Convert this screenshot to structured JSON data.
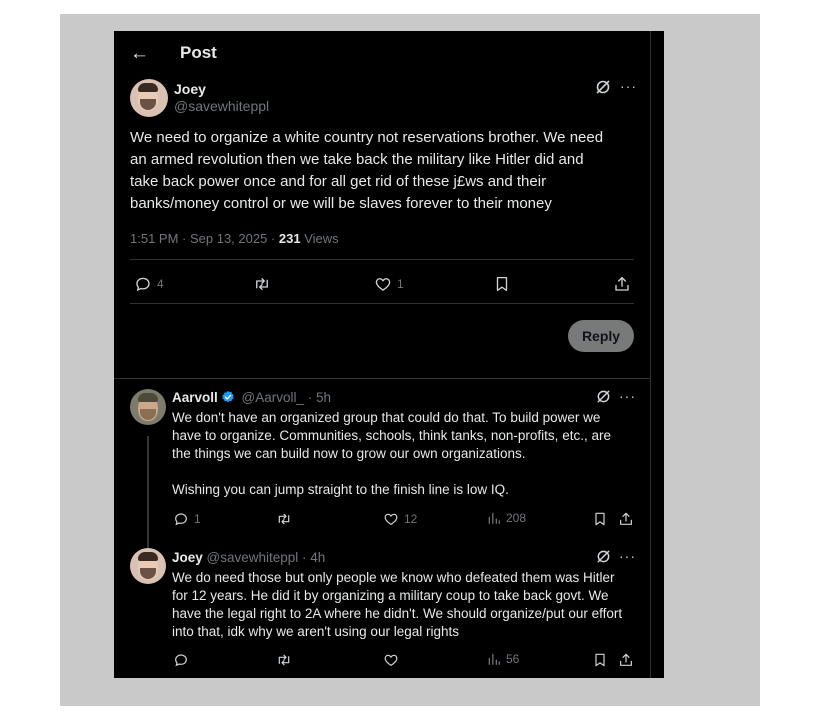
{
  "header": {
    "back_glyph": "←",
    "title": "Post"
  },
  "main_post": {
    "name": "Joey",
    "handle": "@savewhiteppl",
    "lines": [
      "We need to organize a white country not reservations brother. We need",
      "an armed revolution then we take back the military like Hitler did and",
      "take back power once and for all get rid of these j£ws and their",
      "banks/money control or we will be slaves forever to their money"
    ],
    "timestamp": "1:51 PM · Sep 13, 2025 · ",
    "views_count": "231",
    "views_label": " Views",
    "actions": {
      "replies": "4",
      "reposts": "",
      "likes": "1"
    }
  },
  "reply_button": "Reply",
  "replies": [
    {
      "name": "Aarvoll",
      "verified": true,
      "handle": "@Aarvoll_ · 5h",
      "lines": [
        "We don't have an organized group that could do that. To build power we",
        "have to organize. Communities, schools, think tanks, non-profits, etc., are",
        "the things we can build now to grow our own organizations.",
        "",
        "Wishing you can jump straight to the finish line is low IQ."
      ],
      "actions": {
        "replies": "1",
        "reposts": "",
        "likes": "12",
        "views": "208"
      }
    },
    {
      "name": "Joey",
      "verified": false,
      "handle": "@savewhiteppl · 4h",
      "lines": [
        "We do need those but only people we know who defeated them was Hitler",
        "for 12 years. He did it by organizing a military coup to take back govt. We",
        "have the legal right to 2A where he didn't. We should organize/put our effort",
        "into that, idk why we aren't using our legal rights"
      ],
      "actions": {
        "replies": "",
        "reposts": "",
        "likes": "",
        "views": "56"
      }
    }
  ],
  "colors": {
    "background": "#000000",
    "text": "#e7e9ea",
    "muted": "#71767b",
    "verified": "#1d9bf0",
    "frame": "#c9c9c9"
  },
  "icons": [
    "back-arrow-icon",
    "grok-icon",
    "more-icon",
    "reply-icon",
    "repost-icon",
    "like-icon",
    "bookmark-icon",
    "share-icon",
    "views-icon",
    "verified-badge-icon"
  ]
}
